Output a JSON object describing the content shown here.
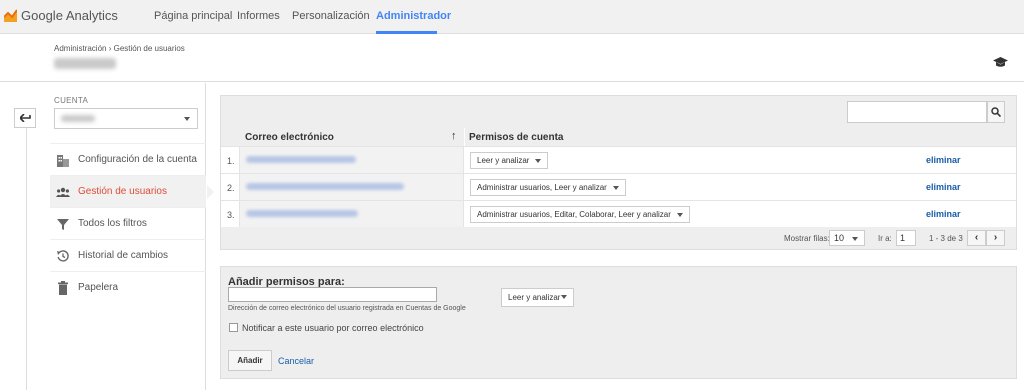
{
  "app": {
    "name": "Google Analytics",
    "accent": "#4285f4",
    "danger": "#dd4b39",
    "link": "#1a5ea8"
  },
  "nav": {
    "items": [
      "Página principal",
      "Informes",
      "Personalización",
      "Administrador"
    ],
    "active": "Administrador"
  },
  "breadcrumb": {
    "root": "Administración",
    "separator": "›",
    "current": "Gestión de usuarios"
  },
  "header_icons": [
    "graduation-cap-icon"
  ],
  "sidebar": {
    "back_icon": "arrow-left-icon",
    "account_label": "CUENTA",
    "items": [
      {
        "label": "Configuración de la cuenta",
        "icon": "building-icon",
        "active": false
      },
      {
        "label": "Gestión de usuarios",
        "icon": "users-icon",
        "active": true
      },
      {
        "label": "Todos los filtros",
        "icon": "filter-icon",
        "active": false
      },
      {
        "label": "Historial de cambios",
        "icon": "history-icon",
        "active": false
      },
      {
        "label": "Papelera",
        "icon": "trash-icon",
        "active": false
      }
    ]
  },
  "table": {
    "search_icon": "search-icon",
    "columns": [
      "Correo electrónico",
      "Permisos de cuenta"
    ],
    "sort_icon": "arrow-up-icon",
    "rows": [
      {
        "num": "1.",
        "permission": "Leer y analizar",
        "action": "eliminar"
      },
      {
        "num": "2.",
        "permission": "Administrar usuarios, Leer y analizar",
        "action": "eliminar"
      },
      {
        "num": "3.",
        "permission": "Administrar usuarios, Editar, Colaborar, Leer y analizar",
        "action": "eliminar"
      }
    ],
    "pager": {
      "rows_label": "Mostrar filas:",
      "rows_value": "10",
      "goto_label": "Ir a:",
      "goto_value": "1",
      "count": "1 - 3 de 3",
      "prev": "‹",
      "next": "›"
    }
  },
  "add": {
    "title": "Añadir permisos para:",
    "email_value": "",
    "help": "Dirección de correo electrónico del usuario registrada en Cuentas de Google",
    "permission": "Leer y analizar",
    "notify_label": "Notificar a este usuario por correo electrónico",
    "notify_checked": false,
    "submit": "Añadir",
    "cancel": "Cancelar"
  }
}
